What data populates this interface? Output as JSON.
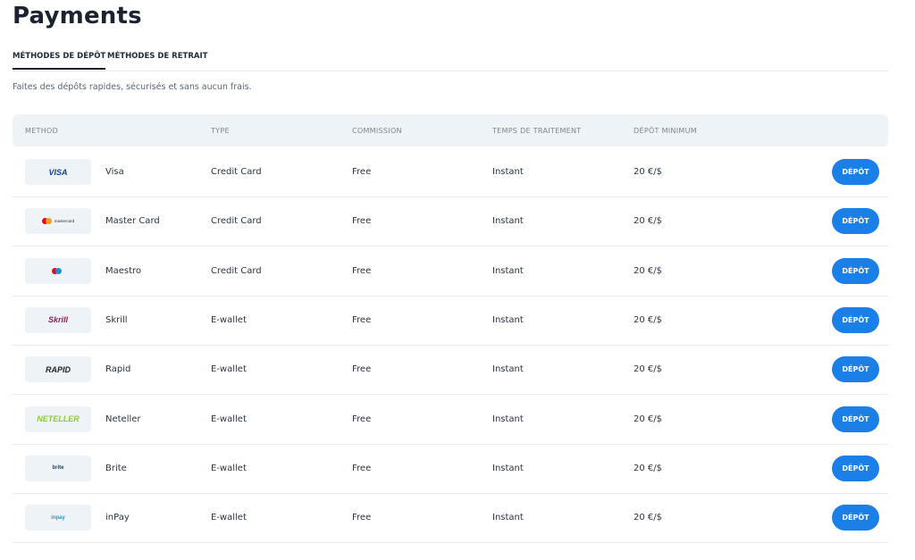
{
  "page": {
    "title": "Payments",
    "subtitle": "Faites des dépôts rapides, sécurisés et sans aucun frais."
  },
  "tabs": [
    {
      "label": "MÉTHODES DE DÉPÔT",
      "active": true
    },
    {
      "label": "MÉTHODES DE RETRAIT",
      "active": false
    }
  ],
  "table": {
    "headers": {
      "method": "METHOD",
      "type": "TYPE",
      "commission": "COMMISSION",
      "processing": "TEMPS DE TRAITEMENT",
      "minimum": "DÉPÔT MINIMUM"
    },
    "deposit_label": "DÉPÔT",
    "rows": [
      {
        "logo_icon": "visa-logo-icon",
        "logo_text": "VISA",
        "logo_color": "#1a3e8c",
        "method": "Visa",
        "type": "Credit Card",
        "commission": "Free",
        "processing": "Instant",
        "minimum": "20 €/$"
      },
      {
        "logo_icon": "mastercard-logo-icon",
        "logo_text": "mastercard",
        "logo_color": "#333333",
        "method": "Master Card",
        "type": "Credit Card",
        "commission": "Free",
        "processing": "Instant",
        "minimum": "20 €/$"
      },
      {
        "logo_icon": "maestro-logo-icon",
        "logo_text": "Maestro",
        "logo_color": "#0b5fb8",
        "method": "Maestro",
        "type": "Credit Card",
        "commission": "Free",
        "processing": "Instant",
        "minimum": "20 €/$"
      },
      {
        "logo_icon": "skrill-logo-icon",
        "logo_text": "Skrill",
        "logo_color": "#862165",
        "method": "Skrill",
        "type": "E-wallet",
        "commission": "Free",
        "processing": "Instant",
        "minimum": "20 €/$"
      },
      {
        "logo_icon": "rapid-logo-icon",
        "logo_text": "RAPID",
        "logo_color": "#222222",
        "method": "Rapid",
        "type": "E-wallet",
        "commission": "Free",
        "processing": "Instant",
        "minimum": "20 €/$"
      },
      {
        "logo_icon": "neteller-logo-icon",
        "logo_text": "NETELLER",
        "logo_color": "#8dc641",
        "method": "Neteller",
        "type": "E-wallet",
        "commission": "Free",
        "processing": "Instant",
        "minimum": "20 €/$"
      },
      {
        "logo_icon": "brite-logo-icon",
        "logo_text": "brite",
        "logo_color": "#2b3f63",
        "method": "Brite",
        "type": "E-wallet",
        "commission": "Free",
        "processing": "Instant",
        "minimum": "20 €/$"
      },
      {
        "logo_icon": "inpay-logo-icon",
        "logo_text": "inpay",
        "logo_color": "#1e9ad6",
        "method": "inPay",
        "type": "E-wallet",
        "commission": "Free",
        "processing": "Instant",
        "minimum": "20 €/$"
      }
    ]
  },
  "colors": {
    "accent": "#1b7fe8",
    "header_bg": "#eef3f7"
  }
}
